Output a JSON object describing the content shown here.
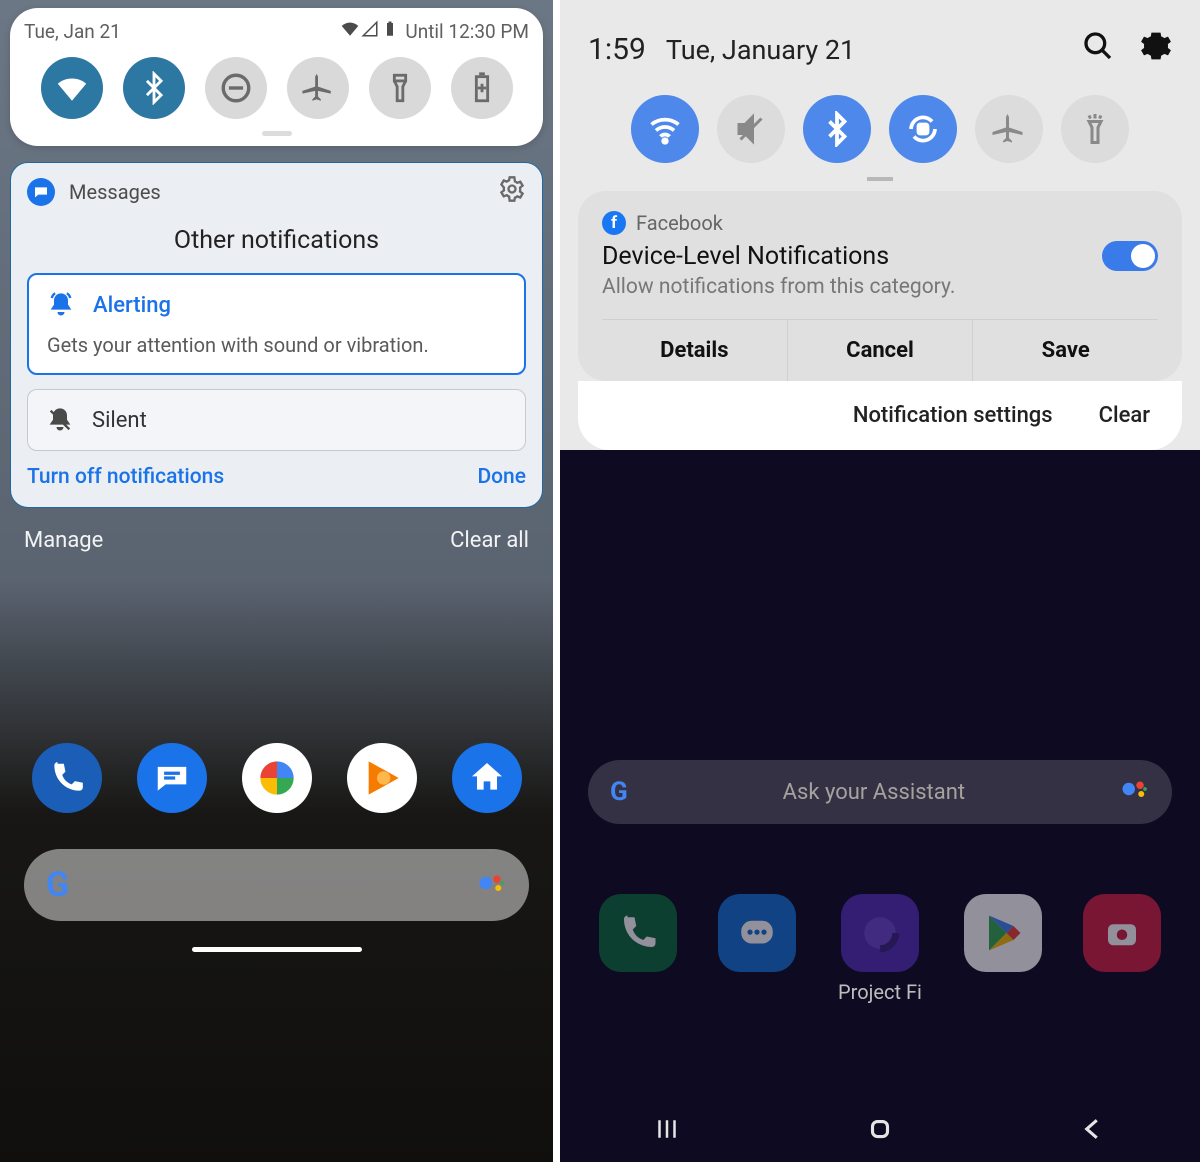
{
  "left": {
    "status": {
      "date": "Tue, Jan 21",
      "until": "Until 12:30 PM"
    },
    "toggles": [
      "wifi",
      "bluetooth",
      "dnd",
      "airplane",
      "flashlight",
      "battery-saver"
    ],
    "notification": {
      "app": "Messages",
      "section_title": "Other notifications",
      "alerting": {
        "label": "Alerting",
        "desc": "Gets your attention with sound or vibration."
      },
      "silent": {
        "label": "Silent"
      },
      "turn_off": "Turn off notifications",
      "done": "Done"
    },
    "shade": {
      "manage": "Manage",
      "clear_all": "Clear all"
    },
    "dock": [
      "phone",
      "messages",
      "photos",
      "play-music",
      "nest"
    ]
  },
  "right": {
    "status": {
      "time": "1:59",
      "date": "Tue, January 21"
    },
    "toggles": [
      "wifi",
      "mute",
      "bluetooth",
      "rotate",
      "airplane",
      "flashlight"
    ],
    "notification": {
      "app": "Facebook",
      "title": "Device-Level Notifications",
      "subtitle": "Allow notifications from this category.",
      "buttons": {
        "details": "Details",
        "cancel": "Cancel",
        "save": "Save"
      }
    },
    "bottom_actions": {
      "settings": "Notification settings",
      "clear": "Clear"
    },
    "search_placeholder": "Ask your Assistant",
    "dock_label": "Project Fi",
    "dock": [
      "phone",
      "messages",
      "browser",
      "play-store",
      "camera"
    ]
  }
}
